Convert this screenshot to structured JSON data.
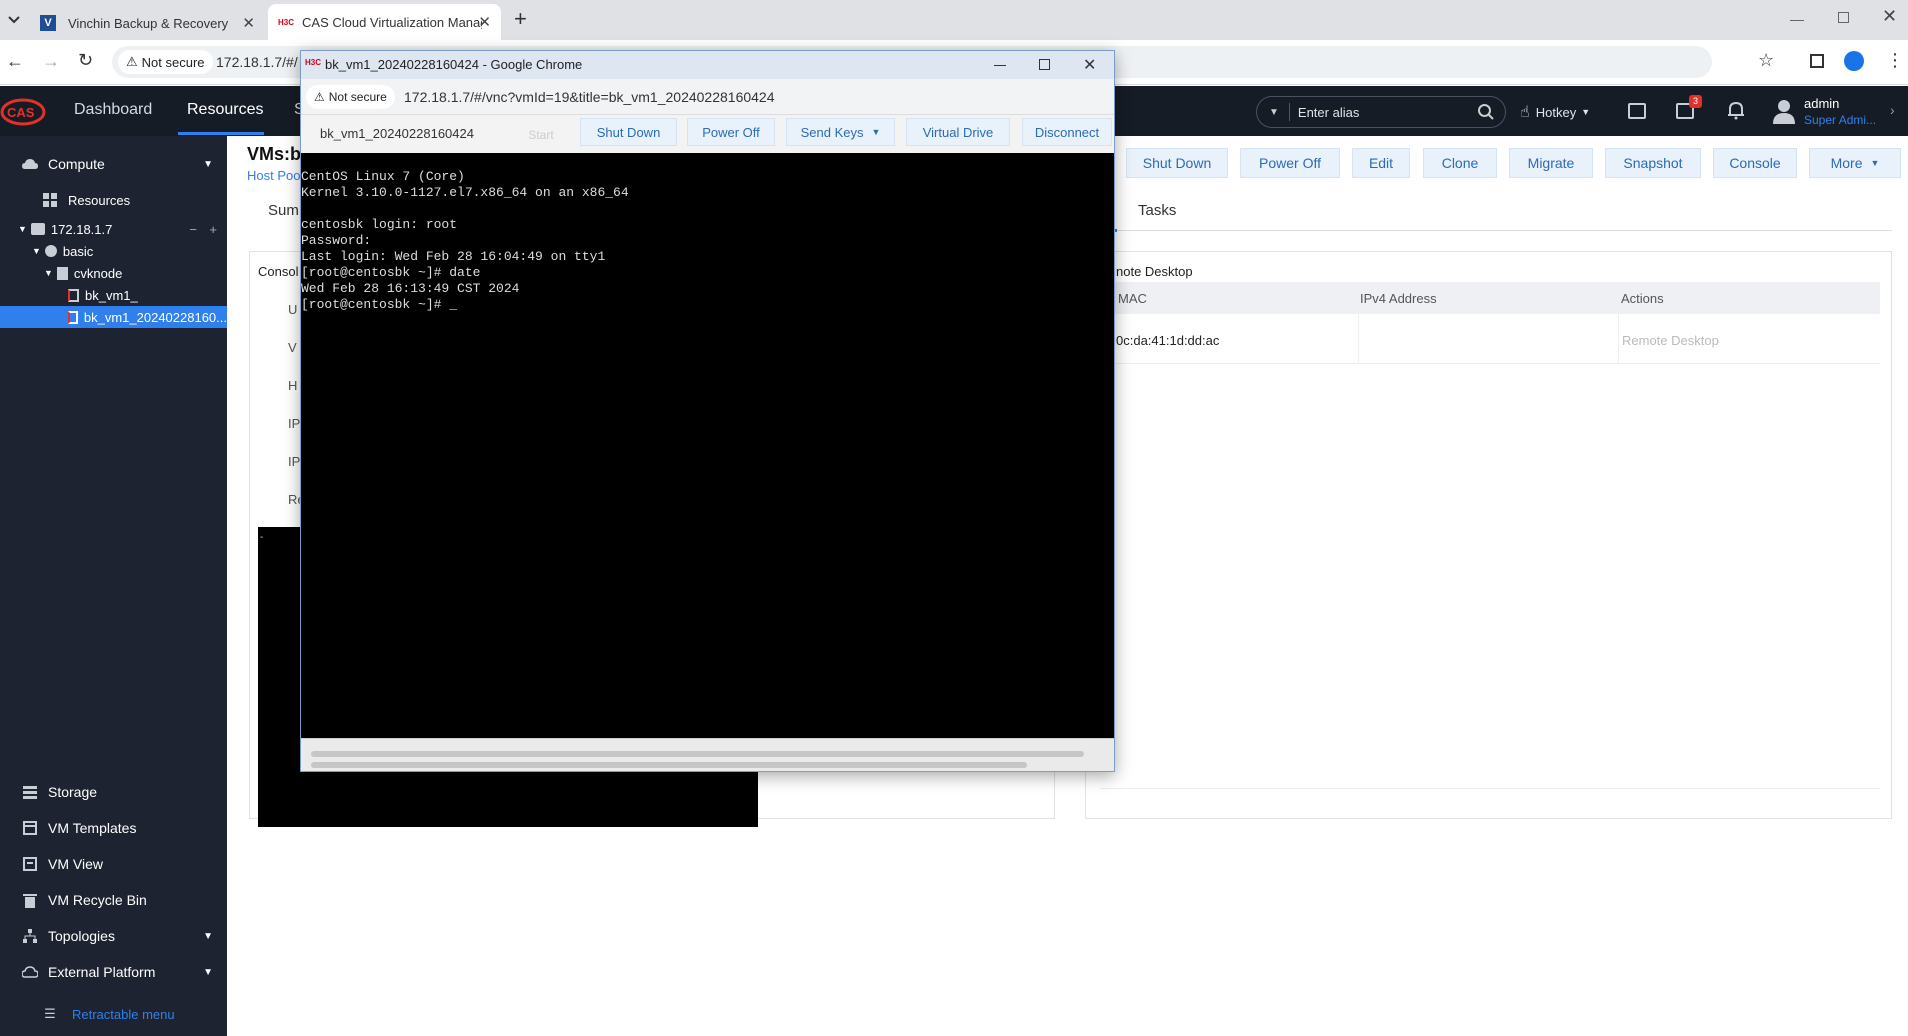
{
  "browser": {
    "tabs": [
      {
        "favicon": "V",
        "title": "Vinchin Backup & Recovery"
      },
      {
        "favicon": "H3C",
        "title": "CAS Cloud Virtualization Manag"
      }
    ],
    "not_secure": "Not secure",
    "url": "172.18.1.7/#/"
  },
  "app": {
    "logo": "CAS",
    "nav": [
      {
        "label": "Dashboard"
      },
      {
        "label": "Resources"
      },
      {
        "label": "S"
      }
    ],
    "alias_placeholder": "Enter alias",
    "hotkey": "Hotkey",
    "notif_count": "3",
    "user_name": "admin",
    "user_role": "Super Admi..."
  },
  "sidebar": {
    "compute": "Compute",
    "resources": "Resources",
    "tree": {
      "host": "172.18.1.7",
      "cluster": "basic",
      "node": "cvknode",
      "vm1": "bk_vm1_",
      "vm2": "bk_vm1_20240228160..."
    },
    "bottom": [
      {
        "label": "Storage",
        "icon": "storage-icon"
      },
      {
        "label": "VM Templates",
        "icon": "template-icon"
      },
      {
        "label": "VM View",
        "icon": "view-icon"
      },
      {
        "label": "VM Recycle Bin",
        "icon": "trash-icon"
      },
      {
        "label": "Topologies",
        "icon": "topology-icon"
      },
      {
        "label": "External Platform",
        "icon": "cloud-icon"
      }
    ],
    "retractable": "Retractable menu"
  },
  "main": {
    "title": "VMs:b",
    "breadcrumb": "Host Poo",
    "tab_summary": "Sum",
    "tab_tasks": "Tasks",
    "toolbar": [
      "Shut Down",
      "Power Off",
      "Edit",
      "Clone",
      "Migrate",
      "Snapshot",
      "Console",
      "More"
    ],
    "console_label": "Consol",
    "left_labels": [
      "U",
      "V",
      "H",
      "IP",
      "IP",
      "Re"
    ],
    "remote_desktop_title": "note Desktop",
    "table_headers": [
      "MAC",
      "IPv4 Address",
      "Actions"
    ],
    "table_row": {
      "mac": "0c:da:41:1d:dd:ac",
      "ipv4": "",
      "action": "Remote Desktop"
    }
  },
  "popup": {
    "favicon": "H3C",
    "title": "bk_vm1_20240228160424 - Google Chrome",
    "not_secure": "Not secure",
    "url": "172.18.1.7/#/vnc?vmId=19&title=bk_vm1_20240228160424",
    "vm_name": "bk_vm1_20240228160424",
    "buttons": {
      "start": "Start",
      "shutdown": "Shut Down",
      "poweroff": "Power Off",
      "sendkeys": "Send Keys",
      "vdrive": "Virtual Drive",
      "disconnect": "Disconnect"
    },
    "terminal": [
      "CentOS Linux 7 (Core)",
      "Kernel 3.10.0-1127.el7.x86_64 on an x86_64",
      "",
      "centosbk login: root",
      "Password:",
      "Last login: Wed Feb 28 16:04:49 on tty1",
      "[root@centosbk ~]# date",
      "Wed Feb 28 16:13:49 CST 2024",
      "[root@centosbk ~]# _"
    ]
  }
}
